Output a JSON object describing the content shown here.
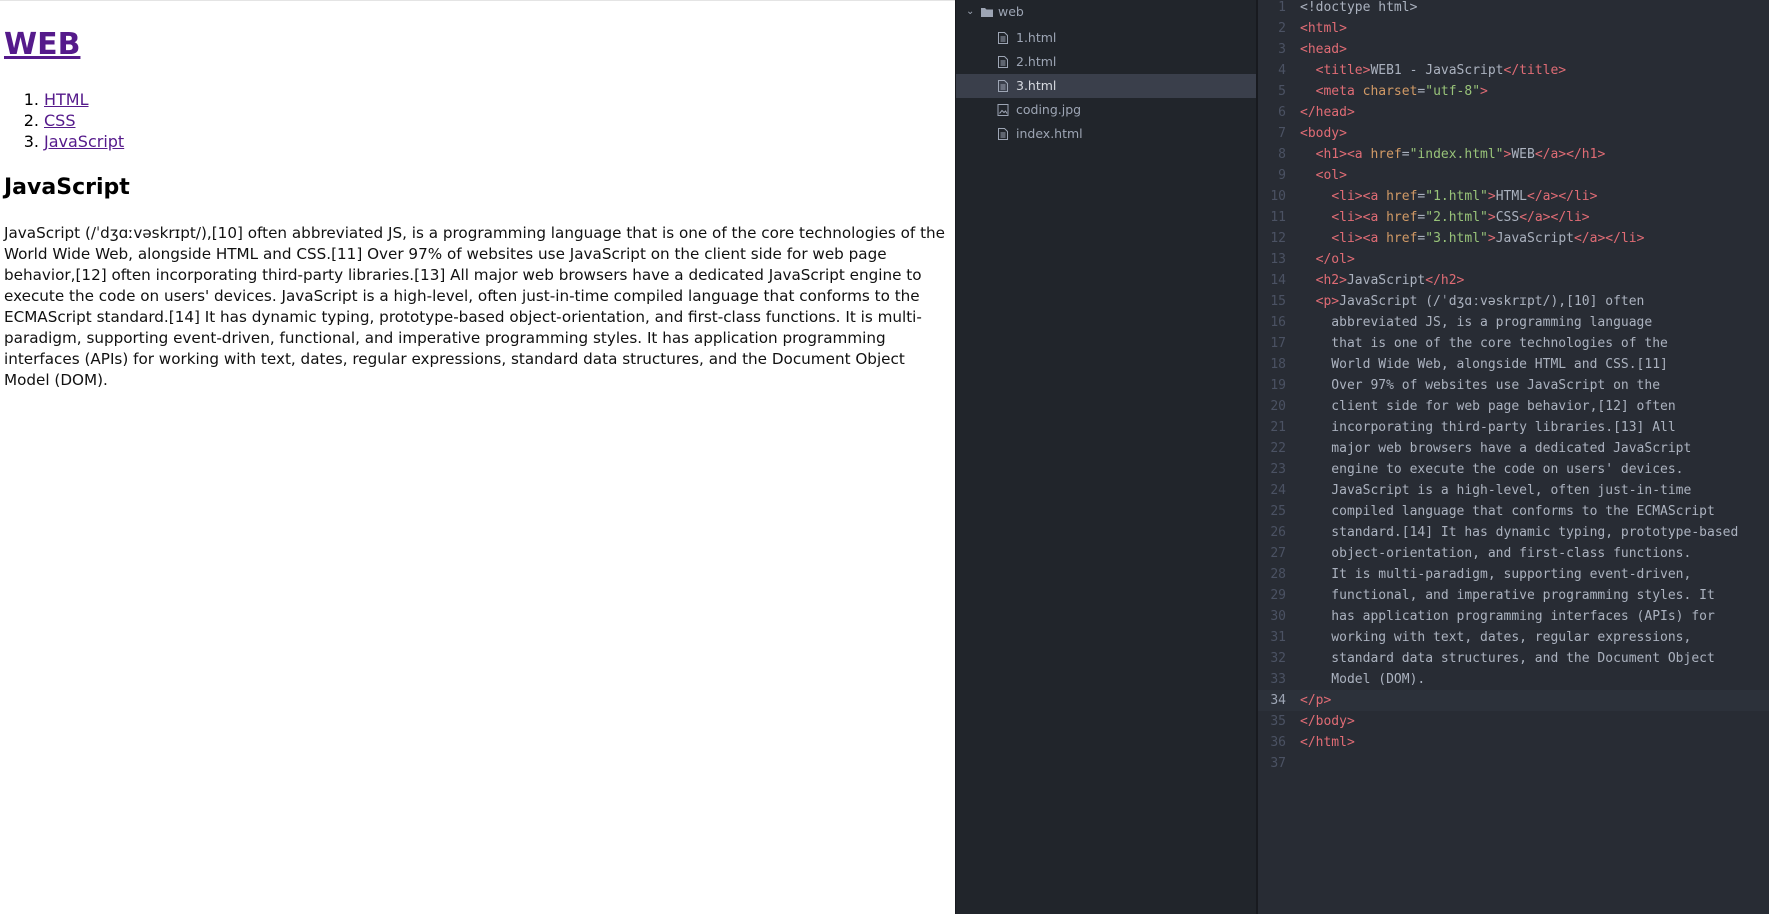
{
  "browser": {
    "heading": "WEB",
    "nav": [
      {
        "num": "1.",
        "label": "HTML"
      },
      {
        "num": "2.",
        "label": "CSS"
      },
      {
        "num": "3.",
        "label": "JavaScript"
      }
    ],
    "section_title": "JavaScript",
    "paragraph": "JavaScript (/ˈdʒɑːvəskrɪpt/),[10] often abbreviated JS, is a programming language that is one of the core technologies of the World Wide Web, alongside HTML and CSS.[11] Over 97% of websites use JavaScript on the client side for web page behavior,[12] often incorporating third-party libraries.[13] All major web browsers have a dedicated JavaScript engine to execute the code on users' devices. JavaScript is a high-level, often just-in-time compiled language that conforms to the ECMAScript standard.[14] It has dynamic typing, prototype-based object-orientation, and first-class functions. It is multi-paradigm, supporting event-driven, functional, and imperative programming styles. It has application programming interfaces (APIs) for working with text, dates, regular expressions, standard data structures, and the Document Object Model (DOM)."
  },
  "tree": {
    "folder": "web",
    "files": [
      {
        "name": "1.html",
        "icon": "file-icon",
        "selected": false
      },
      {
        "name": "2.html",
        "icon": "file-icon",
        "selected": false
      },
      {
        "name": "3.html",
        "icon": "file-icon",
        "selected": true
      },
      {
        "name": "coding.jpg",
        "icon": "image-file-icon",
        "selected": false
      },
      {
        "name": "index.html",
        "icon": "file-icon",
        "selected": false
      }
    ]
  },
  "editor": {
    "current_line": 34,
    "lines": [
      [
        [
          "doc",
          "<!doctype html>"
        ]
      ],
      [
        [
          "tag",
          "<html>"
        ]
      ],
      [
        [
          "tag",
          "<head>"
        ]
      ],
      [
        [
          "text",
          "  "
        ],
        [
          "tag",
          "<title>"
        ],
        [
          "text",
          "WEB1 - JavaScript"
        ],
        [
          "tag",
          "</title>"
        ]
      ],
      [
        [
          "text",
          "  "
        ],
        [
          "tag",
          "<meta "
        ],
        [
          "attr",
          "charset"
        ],
        [
          "punc",
          "="
        ],
        [
          "str",
          "\"utf-8\""
        ],
        [
          "tag",
          ">"
        ]
      ],
      [
        [
          "tag",
          "</head>"
        ]
      ],
      [
        [
          "tag",
          "<body>"
        ]
      ],
      [
        [
          "text",
          "  "
        ],
        [
          "tag",
          "<h1>"
        ],
        [
          "tag",
          "<a "
        ],
        [
          "attr",
          "href"
        ],
        [
          "punc",
          "="
        ],
        [
          "str",
          "\"index.html\""
        ],
        [
          "tag",
          ">"
        ],
        [
          "text",
          "WEB"
        ],
        [
          "tag",
          "</a>"
        ],
        [
          "tag",
          "</h1>"
        ]
      ],
      [
        [
          "text",
          "  "
        ],
        [
          "tag",
          "<ol>"
        ]
      ],
      [
        [
          "text",
          "    "
        ],
        [
          "tag",
          "<li>"
        ],
        [
          "tag",
          "<a "
        ],
        [
          "attr",
          "href"
        ],
        [
          "punc",
          "="
        ],
        [
          "str",
          "\"1.html\""
        ],
        [
          "tag",
          ">"
        ],
        [
          "text",
          "HTML"
        ],
        [
          "tag",
          "</a>"
        ],
        [
          "tag",
          "</li>"
        ]
      ],
      [
        [
          "text",
          "    "
        ],
        [
          "tag",
          "<li>"
        ],
        [
          "tag",
          "<a "
        ],
        [
          "attr",
          "href"
        ],
        [
          "punc",
          "="
        ],
        [
          "str",
          "\"2.html\""
        ],
        [
          "tag",
          ">"
        ],
        [
          "text",
          "CSS"
        ],
        [
          "tag",
          "</a>"
        ],
        [
          "tag",
          "</li>"
        ]
      ],
      [
        [
          "text",
          "    "
        ],
        [
          "tag",
          "<li>"
        ],
        [
          "tag",
          "<a "
        ],
        [
          "attr",
          "href"
        ],
        [
          "punc",
          "="
        ],
        [
          "str",
          "\"3.html\""
        ],
        [
          "tag",
          ">"
        ],
        [
          "text",
          "JavaScript"
        ],
        [
          "tag",
          "</a>"
        ],
        [
          "tag",
          "</li>"
        ]
      ],
      [
        [
          "text",
          "  "
        ],
        [
          "tag",
          "</ol>"
        ]
      ],
      [
        [
          "text",
          "  "
        ],
        [
          "tag",
          "<h2>"
        ],
        [
          "text",
          "JavaScript"
        ],
        [
          "tag",
          "</h2>"
        ]
      ],
      [
        [
          "text",
          "  "
        ],
        [
          "tag",
          "<p>"
        ],
        [
          "text",
          "JavaScript (/ˈdʒɑːvəskrɪpt/),[10] often"
        ]
      ],
      [
        [
          "text",
          "    abbreviated JS, is a programming language"
        ]
      ],
      [
        [
          "text",
          "    that is one of the core technologies of the"
        ]
      ],
      [
        [
          "text",
          "    World Wide Web, alongside HTML and CSS.[11]"
        ]
      ],
      [
        [
          "text",
          "    Over 97% of websites use JavaScript on the"
        ]
      ],
      [
        [
          "text",
          "    client side for web page behavior,[12] often"
        ]
      ],
      [
        [
          "text",
          "    incorporating third-party libraries.[13] All"
        ]
      ],
      [
        [
          "text",
          "    major web browsers have a dedicated JavaScript"
        ]
      ],
      [
        [
          "text",
          "    engine to execute the code on users' devices."
        ]
      ],
      [
        [
          "text",
          "    JavaScript is a high-level, often just-in-time"
        ]
      ],
      [
        [
          "text",
          "    compiled language that conforms to the ECMAScript"
        ]
      ],
      [
        [
          "text",
          "    standard.[14] It has dynamic typing, prototype-based"
        ]
      ],
      [
        [
          "text",
          "    object-orientation, and first-class functions."
        ]
      ],
      [
        [
          "text",
          "    It is multi-paradigm, supporting event-driven,"
        ]
      ],
      [
        [
          "text",
          "    functional, and imperative programming styles. It"
        ]
      ],
      [
        [
          "text",
          "    has application programming interfaces (APIs) for"
        ]
      ],
      [
        [
          "text",
          "    working with text, dates, regular expressions,"
        ]
      ],
      [
        [
          "text",
          "    standard data structures, and the Document Object"
        ]
      ],
      [
        [
          "text",
          "    Model (DOM)."
        ]
      ],
      [
        [
          "tag",
          "</p>"
        ]
      ],
      [
        [
          "tag",
          "</body>"
        ]
      ],
      [
        [
          "tag",
          "</html>"
        ]
      ],
      []
    ]
  },
  "colors": {
    "link_visited": "#551a8b",
    "tree_bg": "#21252b",
    "tree_selected": "#3a3f4b",
    "editor_bg": "#282c34",
    "tag": "#e06c75",
    "attr": "#d19a66",
    "string": "#98c379"
  }
}
